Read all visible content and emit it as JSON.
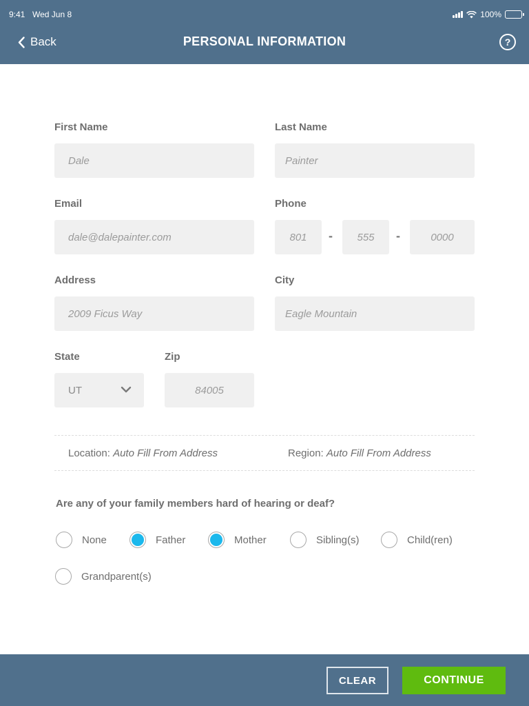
{
  "status_bar": {
    "time": "9:41",
    "date": "Wed Jun 8",
    "battery": "100%"
  },
  "header": {
    "back_label": "Back",
    "title": "PERSONAL INFORMATION",
    "help_label": "?"
  },
  "form": {
    "first_name": {
      "label": "First Name",
      "placeholder": "Dale"
    },
    "last_name": {
      "label": "Last Name",
      "placeholder": "Painter"
    },
    "email": {
      "label": "Email",
      "placeholder": "dale@dalepainter.com"
    },
    "phone": {
      "label": "Phone",
      "area": "801",
      "prefix": "555",
      "line": "0000",
      "separator": "-"
    },
    "address": {
      "label": "Address",
      "placeholder": "2009 Ficus Way"
    },
    "city": {
      "label": "City",
      "placeholder": "Eagle Mountain"
    },
    "state": {
      "label": "State",
      "value": "UT"
    },
    "zip": {
      "label": "Zip",
      "placeholder": "84005"
    }
  },
  "autofill": {
    "location_label": "Location:",
    "location_value": "Auto Fill From Address",
    "region_label": "Region:",
    "region_value": "Auto Fill From Address"
  },
  "family": {
    "question": "Are any of your family members hard of hearing or deaf?",
    "options": [
      {
        "label": "None",
        "checked": false
      },
      {
        "label": "Father",
        "checked": true
      },
      {
        "label": "Mother",
        "checked": true
      },
      {
        "label": "Sibling(s)",
        "checked": false
      },
      {
        "label": "Child(ren)",
        "checked": false
      },
      {
        "label": "Grandparent(s)",
        "checked": false
      }
    ]
  },
  "footer": {
    "clear_label": "CLEAR",
    "continue_label": "CONTINUE"
  },
  "colors": {
    "header_bg": "#50708c",
    "accent_radio": "#1bb8ec",
    "continue_bg": "#5fbb0f"
  }
}
